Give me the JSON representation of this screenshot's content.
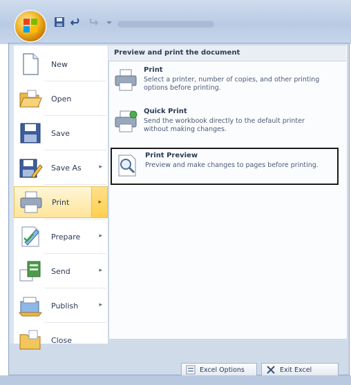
{
  "menu": {
    "items": [
      {
        "label": "New",
        "icon": "new-document-icon",
        "has_submenu": false
      },
      {
        "label": "Open",
        "icon": "open-folder-icon",
        "has_submenu": false
      },
      {
        "label": "Save",
        "icon": "save-disk-icon",
        "has_submenu": false
      },
      {
        "label": "Save As",
        "icon": "save-as-icon",
        "has_submenu": true
      },
      {
        "label": "Print",
        "icon": "printer-icon",
        "has_submenu": true,
        "selected": true
      },
      {
        "label": "Prepare",
        "icon": "prepare-icon",
        "has_submenu": true
      },
      {
        "label": "Send",
        "icon": "send-icon",
        "has_submenu": true
      },
      {
        "label": "Publish",
        "icon": "publish-icon",
        "has_submenu": true
      },
      {
        "label": "Close",
        "icon": "close-folder-icon",
        "has_submenu": false
      }
    ]
  },
  "submenu": {
    "header": "Preview and print the document",
    "entries": [
      {
        "title": "Print",
        "description": "Select a printer, number of copies, and other printing options before printing."
      },
      {
        "title": "Quick Print",
        "description": "Send the workbook directly to the default printer without making changes."
      },
      {
        "title": "Print Preview",
        "description": "Preview and make changes to pages before printing."
      }
    ]
  },
  "footer": {
    "options_label": "Excel Options",
    "exit_label": "Exit Excel"
  },
  "colors": {
    "accent": "#f1b21f",
    "selected_bg": "#ffe49a",
    "highlight_border": "#1a1a1a"
  }
}
